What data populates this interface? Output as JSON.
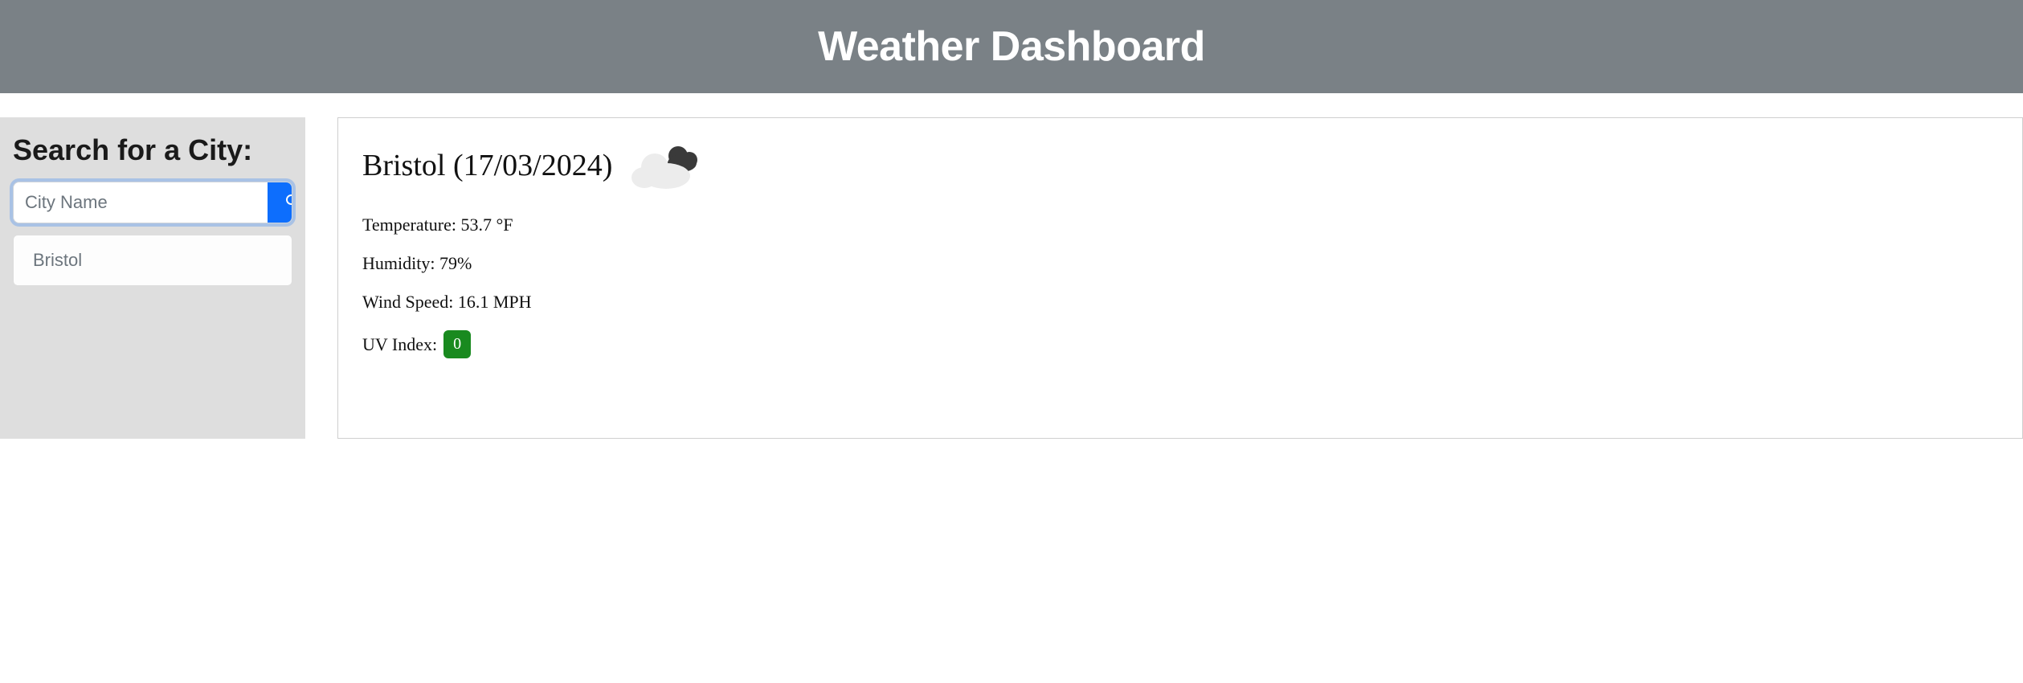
{
  "header": {
    "title": "Weather Dashboard"
  },
  "sidebar": {
    "title": "Search for a City:",
    "search_placeholder": "City Name",
    "search_value": "",
    "history": [
      {
        "label": "Bristol"
      }
    ]
  },
  "main": {
    "city_heading": "Bristol (17/03/2024)",
    "temperature_line": "Temperature: 53.7 °F",
    "humidity_line": "Humidity: 79%",
    "wind_line": "Wind Speed: 16.1 MPH",
    "uv_label": "UV Index: ",
    "uv_value": "0"
  }
}
